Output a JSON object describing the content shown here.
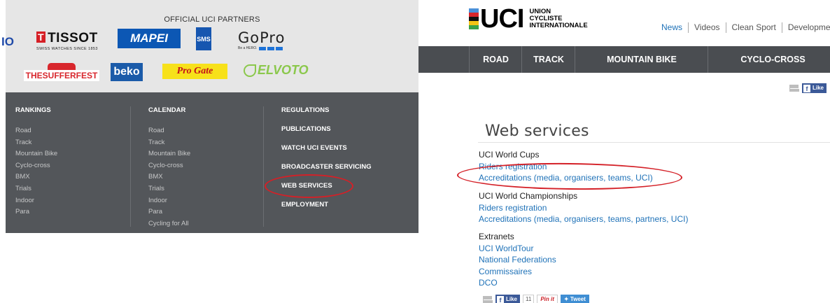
{
  "left": {
    "partners_title": "OFFICIAL UCI PARTNERS",
    "logos": {
      "partial": "IO",
      "tissot": "TISSOT",
      "tissot_cross": "T",
      "tissot_tagline": "SWISS WATCHES SINCE 1853",
      "mapei": "MAPEI",
      "sms": "SMS",
      "gopro": "GoPro",
      "gopro_tag": "Be a HERO.",
      "sufferfest": "THESUFFERFEST",
      "beko": "beko",
      "progate": "Pro Gate",
      "elvoto": "ELVOTO"
    },
    "footer": {
      "rankings": {
        "heading": "RANKINGS",
        "items": [
          "Road",
          "Track",
          "Mountain Bike",
          "Cyclo-cross",
          "BMX",
          "Trials",
          "Indoor",
          "Para"
        ]
      },
      "calendar": {
        "heading": "CALENDAR",
        "items": [
          "Road",
          "Track",
          "Mountain Bike",
          "Cyclo-cross",
          "BMX",
          "Trials",
          "Indoor",
          "Para",
          "Cycling for All"
        ]
      },
      "links": [
        "REGULATIONS",
        "PUBLICATIONS",
        "WATCH UCI EVENTS",
        "BROADCASTER SERVICING",
        "WEB SERVICES",
        "EMPLOYMENT"
      ]
    }
  },
  "right": {
    "logo": {
      "word": "UCI",
      "line1": "UNION",
      "line2": "CYCLISTE",
      "line3": "INTERNATIONALE",
      "stripe_colors": [
        "#4a90d9",
        "#d8262c",
        "#111111",
        "#f3c415",
        "#3aa24a"
      ]
    },
    "top_nav": [
      "News",
      "Videos",
      "Clean Sport",
      "Developme"
    ],
    "main_nav": [
      "ROAD",
      "TRACK",
      "MOUNTAIN BIKE",
      "CYCLO-CROSS"
    ],
    "share_top": {
      "like": "Like"
    },
    "page_title": "Web services",
    "sections": [
      {
        "heading": "UCI World Cups",
        "links": [
          "Riders registration",
          "Accreditations (media, organisers, teams, UCI)"
        ]
      },
      {
        "heading": "UCI World Championships",
        "links": [
          "Riders registration",
          "Accreditations (media, organisers, teams, partners, UCI)"
        ]
      },
      {
        "heading": "Extranets",
        "links": [
          "UCI WorldTour",
          "National Federations",
          "Commissaires",
          "DCO"
        ]
      }
    ],
    "share_bottom": {
      "like": "Like",
      "count": "11",
      "pin": "Pin it",
      "tweet": "Tweet"
    }
  },
  "colors": {
    "link": "#1f72b8",
    "footer_bg": "#53565a",
    "nav_bg": "#4a4d51",
    "highlight_ring": "#d42027"
  }
}
